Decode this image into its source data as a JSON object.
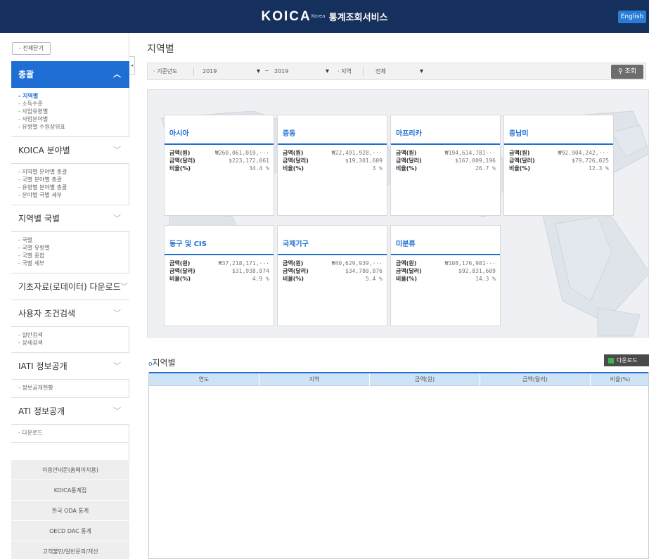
{
  "header": {
    "brand": "KOICA",
    "tagline": "Korea",
    "service": "통계조회서비스",
    "english_label": "English"
  },
  "sidebar": {
    "collapse_all_label": "- 전체닫기",
    "toggle_glyph": "◂",
    "sections": [
      {
        "title": "총괄",
        "active": true,
        "items": [
          "- 지역별",
          "- 소득수준",
          "- 사업유형별",
          "- 사업분야별",
          "- 유형별 수원상위표"
        ]
      },
      {
        "title": "KOICA 분야별",
        "active": false,
        "items": [
          "- 지역별 분야별 총괄",
          "- 국별 분야별 총괄",
          "- 유형별 분야별 총괄",
          "- 분야별 국별 세부"
        ]
      },
      {
        "title": "지역별 국별",
        "active": false,
        "items": [
          "- 국별",
          "- 국별 유형별",
          "- 국별 종합",
          "- 국별 세부"
        ]
      },
      {
        "title": "기초자료(로데이터) 다운로드",
        "active": false,
        "items": []
      },
      {
        "title": "사용자 조건검색",
        "active": false,
        "items": [
          "- 일반검색",
          "- 상세검색"
        ]
      },
      {
        "title": "IATI 정보공개",
        "active": false,
        "items": [
          "- 정보공개현황"
        ]
      },
      {
        "title": "ATI 정보공개",
        "active": false,
        "items": [
          "- 다운로드"
        ]
      }
    ],
    "bottom_links": [
      "이용안내문(홈페이지용)",
      "KOICA통계집",
      "한국 ODA 통계",
      "OECD DAC 통계",
      "고객불만/일반문의/개선"
    ]
  },
  "page": {
    "title": "지역별"
  },
  "filters": {
    "base_year_label": "· 기준년도",
    "year_from": "2019",
    "range_sep": "~",
    "year_to": "2019",
    "region_label": "· 지역",
    "region_value": "전체",
    "search_label": "조회"
  },
  "cards": [
    {
      "region": "아시아",
      "krw": "₩260,061,019,···",
      "usd": "$223,172,061",
      "ratio": "34.4 %"
    },
    {
      "region": "중동",
      "krw": "₩22,491,928,···",
      "usd": "$19,301,609",
      "ratio": "3 %"
    },
    {
      "region": "아프리카",
      "krw": "₩194,614,781···",
      "usd": "$167,009,196",
      "ratio": "26.7 %"
    },
    {
      "region": "중남미",
      "krw": "₩92,904,242,···",
      "usd": "$79,726,025",
      "ratio": "12.3 %"
    },
    {
      "region": "동구 및 CIS",
      "krw": "₩37,218,171,···",
      "usd": "$31,938,874",
      "ratio": "4.9 %"
    },
    {
      "region": "국제기구",
      "krw": "₩40,629,939,···",
      "usd": "$34,780,876",
      "ratio": "5.4 %"
    },
    {
      "region": "미분류",
      "krw": "₩108,176,981···",
      "usd": "$92,831,609",
      "ratio": "14.3 %"
    }
  ],
  "card_labels": {
    "krw": "금액(원)",
    "usd": "금액(달러)",
    "ratio": "비율(%)"
  },
  "table_section": {
    "bullet": "o",
    "title": "지역별",
    "download_label": "다운로드",
    "columns": [
      "연도",
      "지역",
      "금액(원)",
      "금액(달러)",
      "비율(%)"
    ]
  },
  "colors": {
    "header_bg": "#15305c",
    "accent": "#1f6ed4",
    "english_btn": "#2a7dd6"
  }
}
